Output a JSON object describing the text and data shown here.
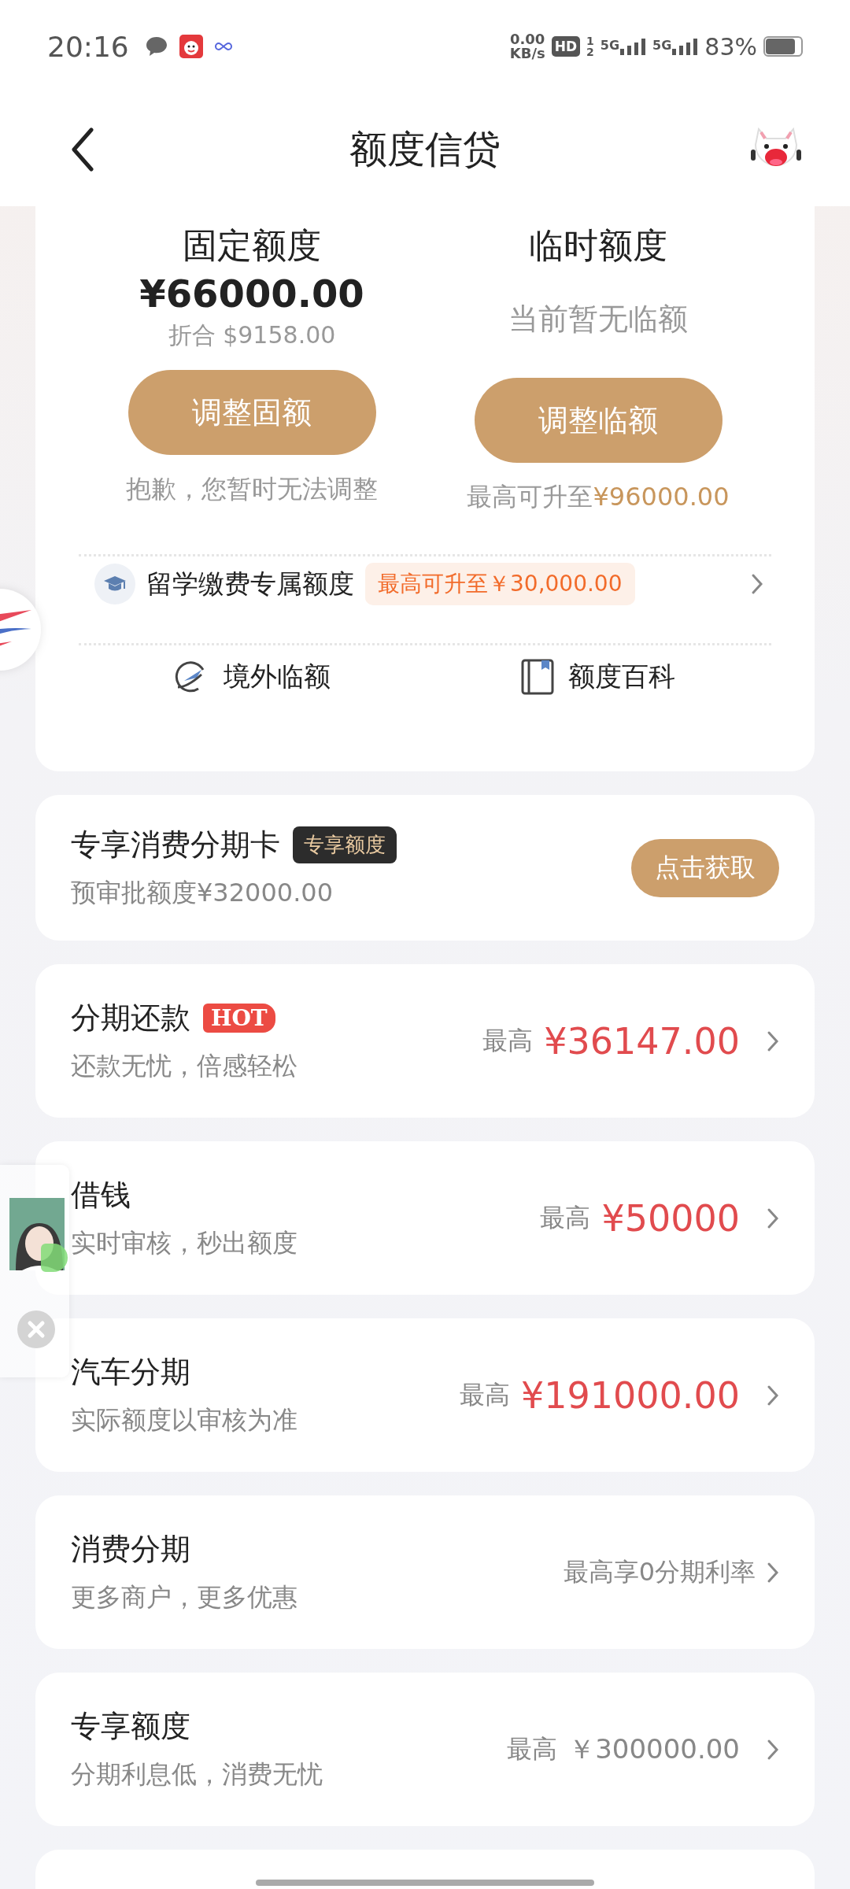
{
  "status_bar": {
    "time": "20:16",
    "speed_value": "0.00",
    "speed_unit": "KB/s",
    "hd": "HD",
    "sim_slots": [
      "1",
      "2"
    ],
    "networks": [
      "5G",
      "5G"
    ],
    "battery": "83%"
  },
  "header": {
    "title": "额度信贷"
  },
  "quota": {
    "columns": [
      {
        "kind": "fixed",
        "title": "固定额度",
        "amount": "¥66000.00",
        "converted": "折合 $9158.00",
        "button": "调整固额",
        "note": "抱歉，您暂时无法调整"
      },
      {
        "kind": "temporary",
        "title": "临时额度",
        "status": "当前暂无临额",
        "button": "调整临额",
        "note": "最高可升至",
        "note_value": "¥96000.00"
      }
    ],
    "promo": {
      "label": "留学缴费专属额度",
      "badge": "最高可升至￥30,000.00"
    },
    "links": [
      {
        "kind": "overseas",
        "label": "境外临额"
      },
      {
        "kind": "guide",
        "label": "额度百科"
      }
    ]
  },
  "offer": {
    "title": "专享消费分期卡",
    "tag": "专享额度",
    "subtitle": "预审批额度¥32000.00",
    "button": "点击获取"
  },
  "products": [
    {
      "title": "分期还款",
      "badge": "HOT",
      "subtitle": "还款无忧，倍感轻松",
      "label": "最高",
      "value": "¥36147.00",
      "highlight": true
    },
    {
      "title": "借钱",
      "subtitle": "实时审核，秒出额度",
      "label": "最高",
      "value": "¥50000",
      "highlight": true
    },
    {
      "title": "汽车分期",
      "subtitle": "实际额度以审核为准",
      "label": "最高",
      "value": "¥191000.00",
      "highlight": true
    },
    {
      "title": "消费分期",
      "subtitle": "更多商户，更多优惠",
      "label": "最高享0分期利率"
    },
    {
      "title": "专享额度",
      "subtitle": "分期利息低，消费无忧",
      "label": "最高",
      "value": "￥300000.00",
      "highlight": false
    }
  ]
}
